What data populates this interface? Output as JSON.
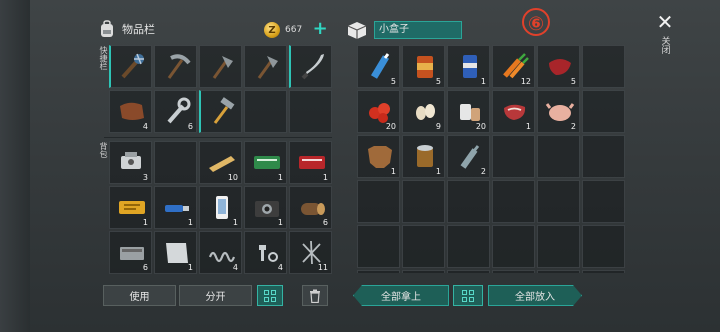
{
  "inventory": {
    "title": "物品栏"
  },
  "coins": {
    "value": "667",
    "icon": "Z"
  },
  "box": {
    "title": "小盒子"
  },
  "badge": "⑥",
  "close": {
    "glyph": "✕",
    "label": "关闭"
  },
  "labels": {
    "quickbar": "快捷栏",
    "backpack": "背包"
  },
  "quick_slots": [
    {
      "item": "spiked-club",
      "count": ""
    },
    {
      "item": "pickaxe",
      "count": ""
    },
    {
      "item": "stone-axe",
      "count": ""
    },
    {
      "item": "stone-axe",
      "count": ""
    },
    {
      "item": "machete",
      "count": ""
    },
    {
      "item": "leather",
      "count": "4"
    },
    {
      "item": "wrench",
      "count": "6"
    },
    {
      "item": "hammer",
      "count": ""
    },
    {
      "item": "empty",
      "count": ""
    },
    {
      "item": "empty",
      "count": ""
    }
  ],
  "backpack_slots": [
    {
      "item": "engine-part",
      "count": "3"
    },
    {
      "item": "empty",
      "count": ""
    },
    {
      "item": "wood-plank",
      "count": "10"
    },
    {
      "item": "green-coupon",
      "count": "1"
    },
    {
      "item": "red-coupon",
      "count": "1"
    },
    {
      "item": "yellow-ticket",
      "count": "1"
    },
    {
      "item": "usb-drive",
      "count": "1"
    },
    {
      "item": "smartphone",
      "count": "1"
    },
    {
      "item": "camera",
      "count": "1"
    },
    {
      "item": "log",
      "count": "6"
    },
    {
      "item": "battery",
      "count": "6"
    },
    {
      "item": "metal-sheet",
      "count": "1"
    },
    {
      "item": "spring",
      "count": "4"
    },
    {
      "item": "bolts",
      "count": "4"
    },
    {
      "item": "nails",
      "count": "11"
    }
  ],
  "box_slots": [
    {
      "item": "water-bottle",
      "count": "5"
    },
    {
      "item": "canned-food",
      "count": "5"
    },
    {
      "item": "soda-can",
      "count": "1"
    },
    {
      "item": "carrots",
      "count": "12"
    },
    {
      "item": "raw-meat",
      "count": "5"
    },
    {
      "item": "empty",
      "count": ""
    },
    {
      "item": "tomatoes",
      "count": "20"
    },
    {
      "item": "garlic",
      "count": "9"
    },
    {
      "item": "pills",
      "count": "20"
    },
    {
      "item": "steak",
      "count": "1"
    },
    {
      "item": "chicken",
      "count": "2"
    },
    {
      "item": "empty",
      "count": ""
    },
    {
      "item": "animal-hide",
      "count": "1"
    },
    {
      "item": "open-can",
      "count": "1"
    },
    {
      "item": "glass-bottle",
      "count": "2"
    },
    {
      "item": "empty",
      "count": ""
    },
    {
      "item": "empty",
      "count": ""
    },
    {
      "item": "empty",
      "count": ""
    },
    {
      "item": "empty",
      "count": ""
    },
    {
      "item": "empty",
      "count": ""
    },
    {
      "item": "empty",
      "count": ""
    },
    {
      "item": "empty",
      "count": ""
    },
    {
      "item": "empty",
      "count": ""
    },
    {
      "item": "empty",
      "count": ""
    },
    {
      "item": "empty",
      "count": ""
    },
    {
      "item": "empty",
      "count": ""
    },
    {
      "item": "empty",
      "count": ""
    },
    {
      "item": "empty",
      "count": ""
    },
    {
      "item": "empty",
      "count": ""
    },
    {
      "item": "empty",
      "count": ""
    },
    {
      "item": "empty",
      "count": ""
    },
    {
      "item": "empty",
      "count": ""
    },
    {
      "item": "empty",
      "count": ""
    },
    {
      "item": "empty",
      "count": ""
    },
    {
      "item": "empty",
      "count": ""
    },
    {
      "item": "empty",
      "count": ""
    }
  ],
  "buttons": {
    "use": "使用",
    "split": "分开",
    "take_all": "全部拿上",
    "put_all": "全部放入"
  },
  "colors": {
    "accent": "#2ec4b6",
    "badge": "#e0412b"
  }
}
